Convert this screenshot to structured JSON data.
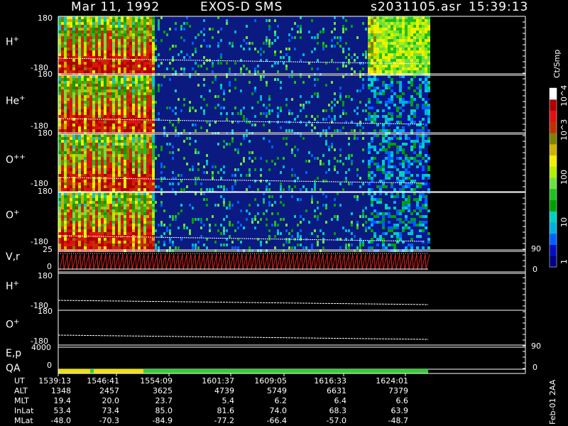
{
  "header": {
    "date": "Mar 11, 1992",
    "instrument": "EXOS-D SMS",
    "file": "s2031105.asr",
    "time": "15:39:13"
  },
  "panels": [
    {
      "id": "h",
      "label": "H",
      "sup": "+",
      "top": "180",
      "bottom": "-180"
    },
    {
      "id": "he",
      "label": "He",
      "sup": "+",
      "top": "180",
      "bottom": "-180"
    },
    {
      "id": "opp",
      "label": "O",
      "sup": "++",
      "top": "180",
      "bottom": "-180"
    },
    {
      "id": "op",
      "label": "O",
      "sup": "+",
      "top": "180",
      "bottom": "-180"
    }
  ],
  "vr_panel": {
    "label": "V,r",
    "left_top": "25",
    "left_bottom": "0",
    "right_top": "90",
    "right_bottom": "0"
  },
  "line_panels": [
    {
      "label": "H",
      "sup": "+",
      "top": "180",
      "bottom": "-180"
    },
    {
      "label": "O",
      "sup": "+",
      "top": "180",
      "bottom": "-180"
    }
  ],
  "ep_panel": {
    "label": "E,p",
    "left_top": "4000",
    "left_bottom": "0",
    "right_top": "90",
    "right_bottom": "0"
  },
  "qa_label": "QA",
  "colorbar": {
    "title": "Ct/Smp",
    "ticks": [
      "1",
      "10",
      "100",
      "10^3",
      "10^4"
    ],
    "colors": [
      "#000080",
      "#0010c0",
      "#0060ff",
      "#00b0e0",
      "#00d0c0",
      "#00a000",
      "#20c020",
      "#70e040",
      "#b0f000",
      "#f0f000",
      "#d0b000",
      "#808000",
      "#c03000",
      "#e01010",
      "#b00000",
      "#ffffff"
    ]
  },
  "footer_label": "Feb-01 2AA",
  "table": {
    "rows": [
      {
        "name": "UT",
        "values": [
          "1539:13",
          "1546:41",
          "1554:09",
          "1601:37",
          "1609:05",
          "1616:33",
          "1624:01"
        ]
      },
      {
        "name": "ALT",
        "values": [
          "1348",
          "2457",
          "3625",
          "4739",
          "5749",
          "6631",
          "7379"
        ]
      },
      {
        "name": "MLT",
        "values": [
          "19.4",
          "20.0",
          "23.7",
          "5.4",
          "6.2",
          "6.4",
          "6.6"
        ]
      },
      {
        "name": "InLat",
        "values": [
          "53.4",
          "73.4",
          "85.0",
          "81.6",
          "74.0",
          "68.3",
          "63.9"
        ]
      },
      {
        "name": "MLat",
        "values": [
          "-48.0",
          "-70.3",
          "-84.9",
          "-77.2",
          "-66.4",
          "-57.0",
          "-48.7"
        ]
      }
    ]
  },
  "colors": {
    "background": "#000000",
    "axis": "#ffffff",
    "qa_yellow": "#f0e000",
    "qa_green": "#30d030",
    "vr_red": "#e02020"
  },
  "chart_data": {
    "type": "heatmap",
    "x_label": "UT",
    "x_ticks": [
      "1539:13",
      "1546:41",
      "1554:09",
      "1601:37",
      "1609:05",
      "1616:33",
      "1624:01"
    ],
    "y_range": [
      -180,
      180
    ],
    "series": [
      {
        "name": "H+",
        "intensity_profile": "high early, spike-like near 1616-1621"
      },
      {
        "name": "He+",
        "intensity_profile": "high early, sparse later"
      },
      {
        "name": "O++",
        "intensity_profile": "high early, sparse later"
      },
      {
        "name": "O+",
        "intensity_profile": "high early, sparse later"
      }
    ],
    "qa_segments": [
      {
        "from": "1539:13",
        "to": "1546:41",
        "quality": "yellow"
      },
      {
        "from": "1546:41",
        "to": "1624:01",
        "quality": "green"
      }
    ]
  }
}
